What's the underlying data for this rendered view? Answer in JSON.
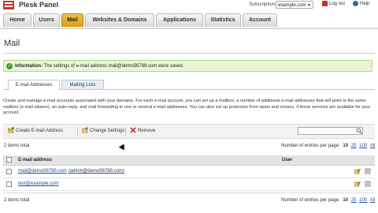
{
  "header": {
    "app_title": "Plesk Panel",
    "subscription_label": "Subscription:",
    "subscription_value": "example.com",
    "logout_label": "Log out",
    "help_label": "Help"
  },
  "nav": {
    "tabs": [
      {
        "label": "Home"
      },
      {
        "label": "Users"
      },
      {
        "label": "Mail"
      },
      {
        "label": "Websites & Domains"
      },
      {
        "label": "Applications"
      },
      {
        "label": "Statistics"
      },
      {
        "label": "Account"
      }
    ],
    "active_index": 2
  },
  "page": {
    "title": "Mail",
    "info_heading": "Information:",
    "info_text": "The settings of e-mail address mail@demo56789.com were saved."
  },
  "subtabs": [
    {
      "label": "E-mail Addresses"
    },
    {
      "label": "Mailing Lists"
    }
  ],
  "description": "Create and manage e-mail accounts associated with your domains. For each e-mail account, you can set up a mailbox, a number of additional e-mail addresses that will point to the same mailbox (e-mail aliases), an auto-reply, and mail forwarding to one or several e-mail addresses. You can also set up protection from spam and viruses, if these services are available for your account.",
  "toolbar": {
    "create_label": "Create E-mail Address",
    "change_label": "Change Settings",
    "remove_label": "Remove",
    "search_placeholder": ""
  },
  "listing": {
    "items_total": "2 items total",
    "entries_label": "Number of entries per page:",
    "page_sizes": [
      "10",
      "25",
      "100",
      "All"
    ],
    "columns": {
      "email": "E-mail address",
      "user": "User"
    },
    "rows": [
      {
        "email": "mail@demo56789.com",
        "extra": "(admin@demo56789.com)"
      },
      {
        "email": "test@example.com",
        "extra": ""
      }
    ]
  },
  "colors": {
    "accent_tab": "#e0a720",
    "info_bg": "#eaf5d8",
    "link": "#1a4f9a"
  },
  "icons": [
    "plesk-logo-icon",
    "logout-icon",
    "help-icon",
    "checkmark-icon",
    "create-mail-icon",
    "settings-icon",
    "remove-icon",
    "search-icon",
    "edit-icon",
    "mailbox-icon"
  ]
}
